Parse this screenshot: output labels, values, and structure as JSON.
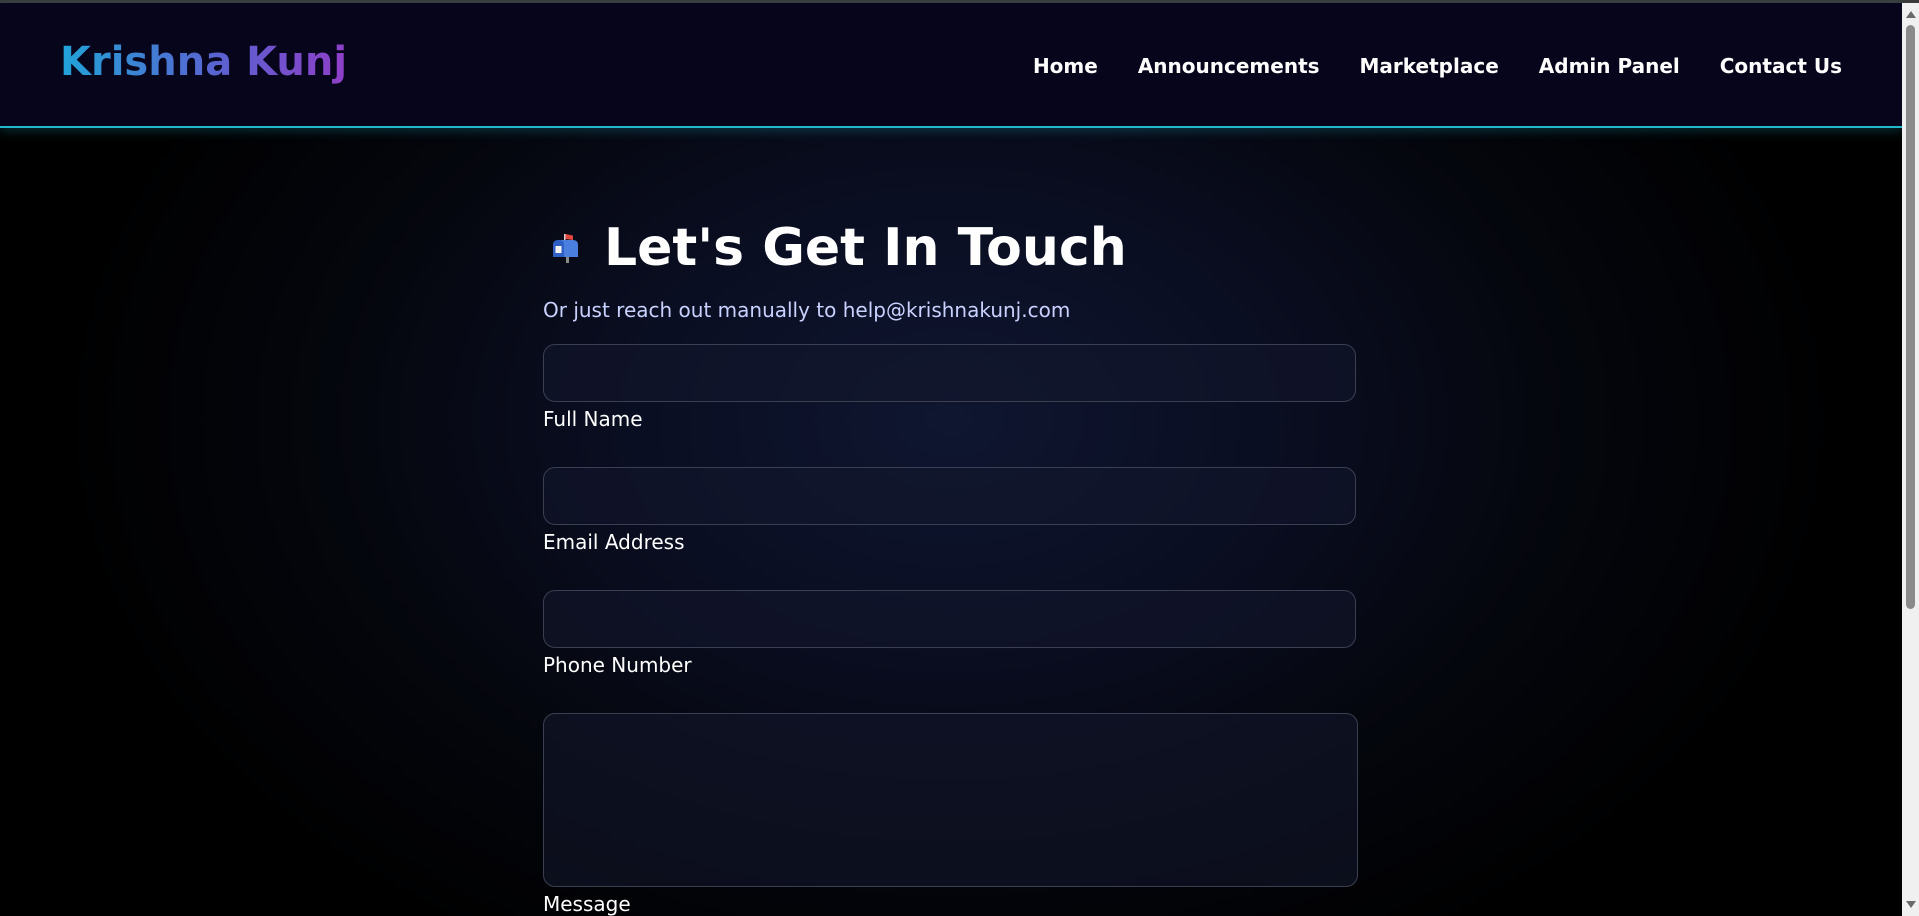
{
  "header": {
    "brand": "Krishna Kunj",
    "nav": [
      {
        "label": "Home"
      },
      {
        "label": "Announcements"
      },
      {
        "label": "Marketplace"
      },
      {
        "label": "Admin Panel"
      },
      {
        "label": "Contact Us"
      }
    ]
  },
  "contact": {
    "icon": "mailbox-icon",
    "title": "Let's Get In Touch",
    "subtitle": "Or just reach out manually to help@krishnakunj.com",
    "fields": [
      {
        "label": "Full Name",
        "value": ""
      },
      {
        "label": "Email Address",
        "value": ""
      },
      {
        "label": "Phone Number",
        "value": ""
      },
      {
        "label": "Message",
        "value": ""
      }
    ]
  },
  "colors": {
    "navbar_bg": "#06051c",
    "accent_border": "#1fb8cc",
    "brand_gradient_start": "#20a4d8",
    "brand_gradient_end": "#8e3fc7",
    "subtitle_text": "#c9d1ff"
  }
}
